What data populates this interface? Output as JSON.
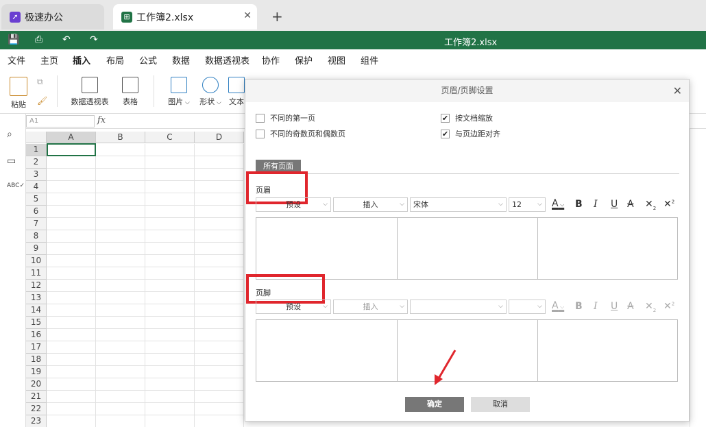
{
  "tabs": [
    {
      "label": "极速办公"
    },
    {
      "label": "工作簿2.xlsx"
    }
  ],
  "window": {
    "title": "工作簿2.xlsx"
  },
  "menu": [
    "文件",
    "主页",
    "插入",
    "布局",
    "公式",
    "数据",
    "数据透视表",
    "协作",
    "保护",
    "视图",
    "组件"
  ],
  "ribbon": {
    "paste": "粘贴",
    "pivot": "数据透视表",
    "table": "表格",
    "picture": "图片",
    "shape": "形状",
    "text": "文本"
  },
  "formula": {
    "namebox": "A1",
    "fx": "fx"
  },
  "grid": {
    "columns": [
      "A",
      "B",
      "C",
      "D"
    ],
    "rows": [
      "1",
      "2",
      "3",
      "4",
      "5",
      "6",
      "7",
      "8",
      "9",
      "10",
      "11",
      "12",
      "13",
      "14",
      "15",
      "16",
      "17",
      "18",
      "19",
      "20",
      "21",
      "22",
      "23"
    ]
  },
  "dialog": {
    "title": "页眉/页脚设置",
    "options": {
      "diff_first": "不同的第一页",
      "diff_odd_even": "不同的奇数页和偶数页",
      "scale_with_doc": "按文档缩放",
      "align_margins": "与页边距对齐"
    },
    "all_pages_tab": "所有页面",
    "header": {
      "label": "页眉",
      "preset": "预设",
      "insert": "插入",
      "font": "宋体",
      "size": "12"
    },
    "footer": {
      "label": "页脚",
      "preset": "预设",
      "insert": "插入",
      "font": "",
      "size": ""
    },
    "ok": "确定",
    "cancel": "取消"
  },
  "colors": {
    "accent": "#217346",
    "highlight": "#e0262d"
  }
}
